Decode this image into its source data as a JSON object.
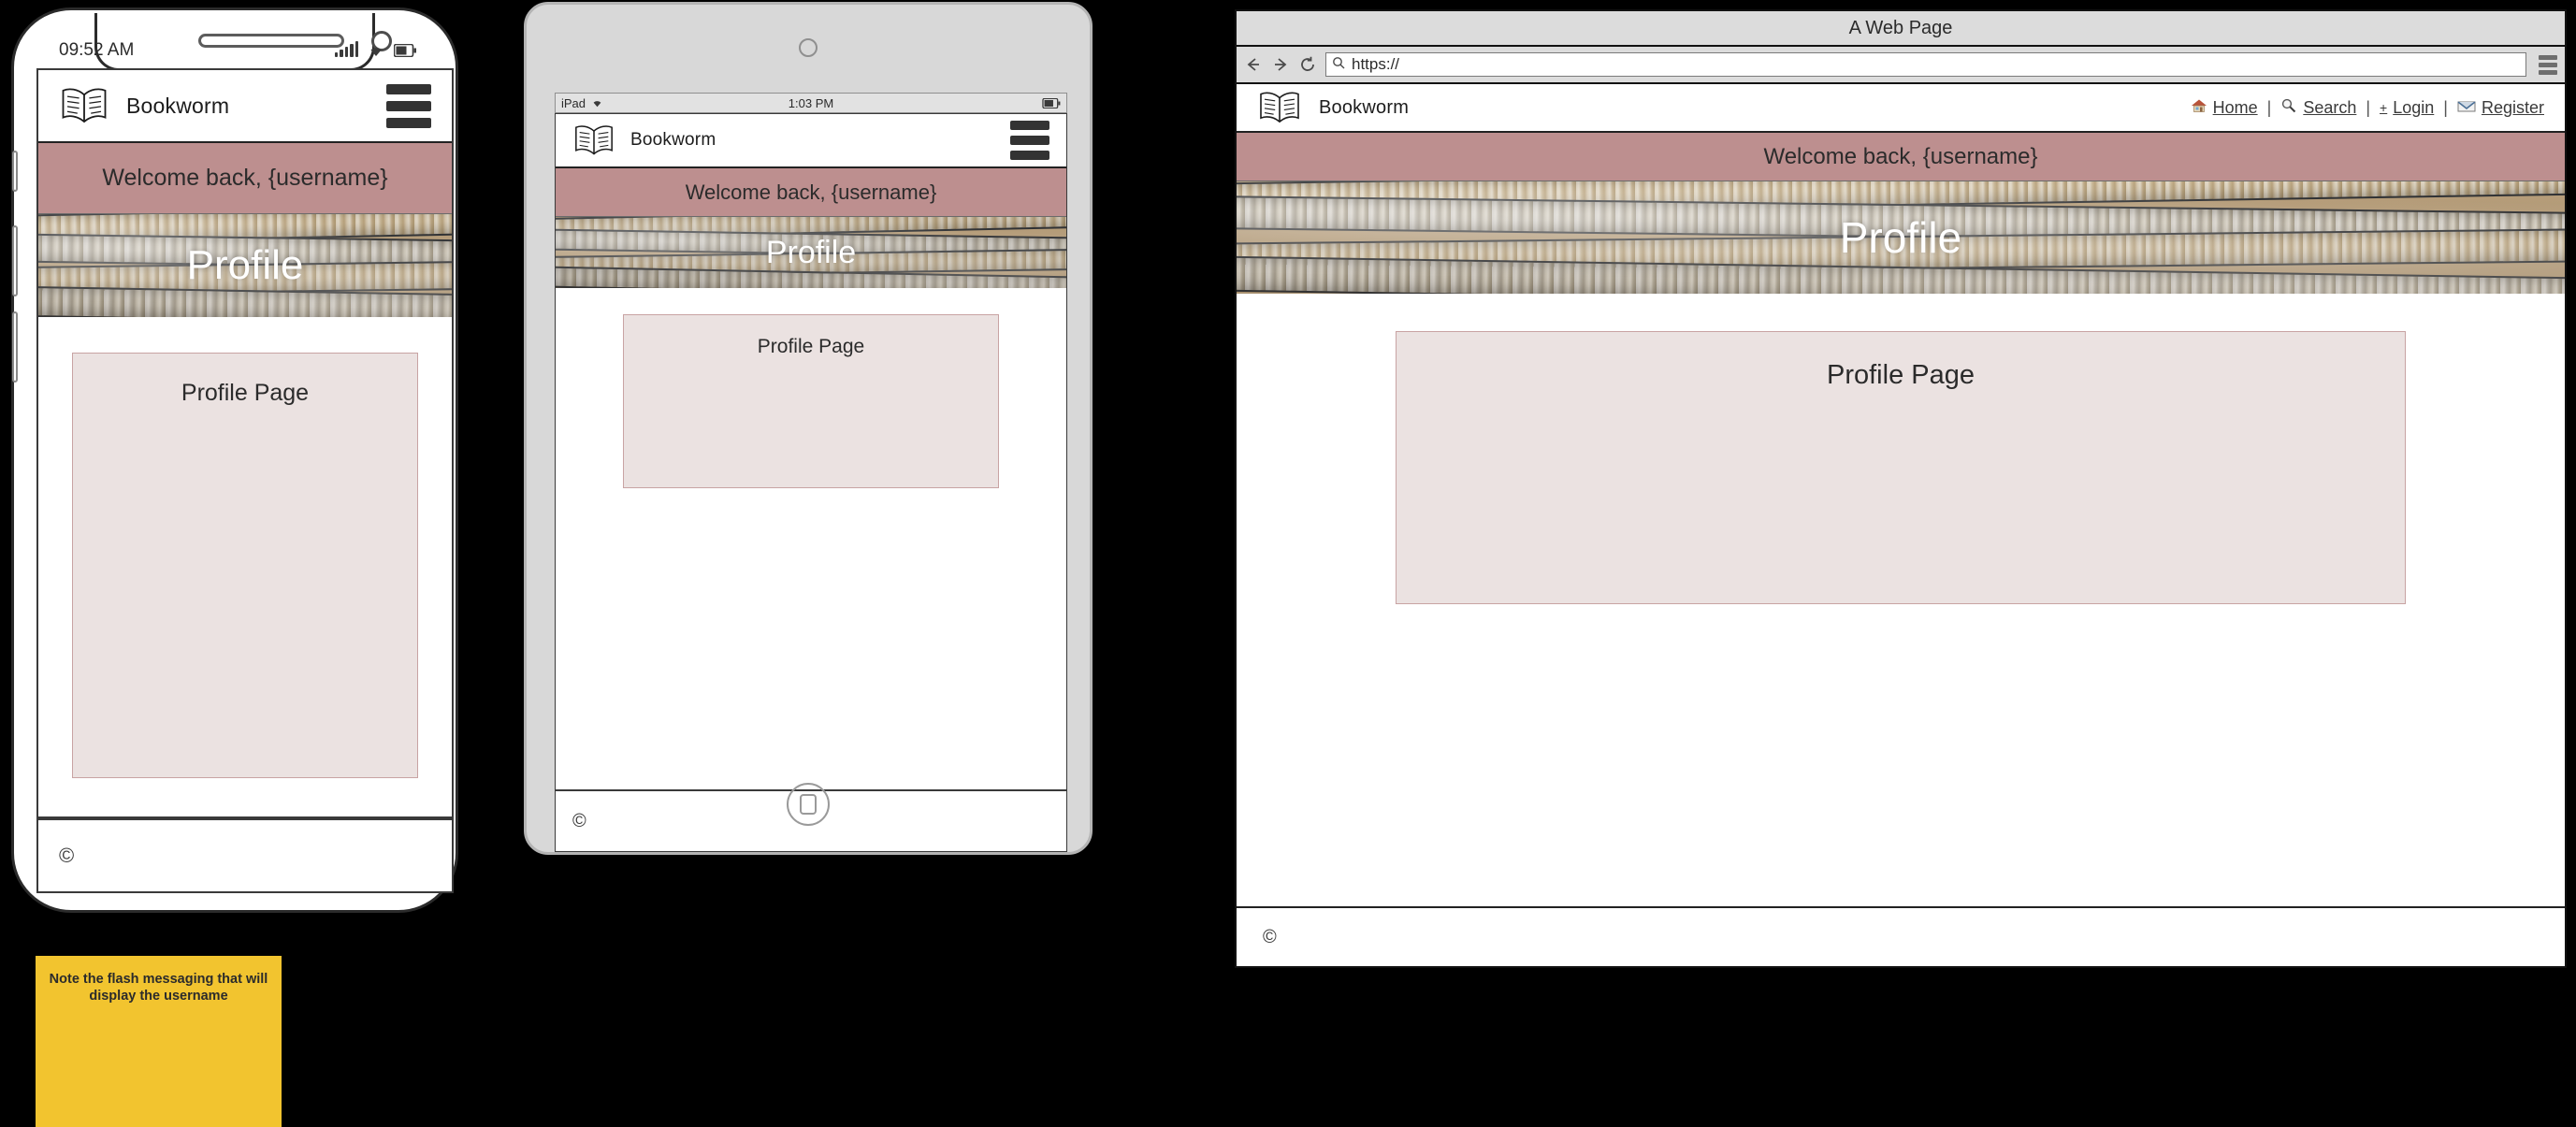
{
  "app": {
    "brand": "Bookworm",
    "logo_icon": "open-book-icon",
    "menu_icon": "hamburger-menu-icon",
    "flash_message": "Welcome back, {username}",
    "hero_title": "Profile",
    "content_title": "Profile Page",
    "footer_copyright": "©"
  },
  "phone": {
    "status_time": "09:52 AM",
    "signal_icon": "signal-bars-icon",
    "wifi_icon": "wifi-icon",
    "battery_icon": "battery-icon"
  },
  "tablet": {
    "device_label": "iPad",
    "wifi_icon": "wifi-icon",
    "status_time": "1:03 PM",
    "battery_icon": "battery-icon",
    "home_button": "home-button"
  },
  "browser": {
    "window_title": "A Web Page",
    "back_icon": "back-arrow-icon",
    "forward_icon": "forward-arrow-icon",
    "reload_icon": "reload-icon",
    "search_icon": "search-icon",
    "url_value": "https://",
    "url_placeholder": "https://",
    "menu_icon": "browser-menu-icon",
    "nav_links": [
      {
        "label": "Home",
        "icon": "house-icon"
      },
      {
        "label": "Search",
        "icon": "magnifier-icon"
      },
      {
        "label": "Login",
        "icon": "plus-icon"
      },
      {
        "label": "Register",
        "icon": "envelope-icon"
      }
    ],
    "separator": "|"
  },
  "note": {
    "text": "Note the flash messaging that will display the username",
    "color": "#f2c42f"
  },
  "colors": {
    "flash_banner": "#bd8f8f",
    "content_box": "#ebe2e1",
    "content_box_border": "#c8a3a3",
    "note": "#f2c42f",
    "hero_text": "#ffffff"
  }
}
